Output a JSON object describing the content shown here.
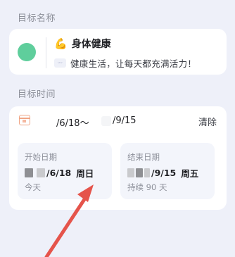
{
  "goal_name_section": {
    "label": "目标名称",
    "title_emoji": "💪",
    "title": "身体健康",
    "description": "健康生活，让每天都充满活力！",
    "color_dot": "#5fce9c"
  },
  "goal_time_section": {
    "label": "目标时间",
    "range_start": "/6/18～",
    "range_end": "/9/15",
    "clear_label": "清除",
    "start": {
      "label": "开始日期",
      "date": "/6/18",
      "weekday": "周日",
      "note": "今天"
    },
    "end": {
      "label": "结束日期",
      "date": "/9/15",
      "weekday": "周五",
      "note": "持续 90 天"
    }
  },
  "annotation_arrow_color": "#e5544b"
}
